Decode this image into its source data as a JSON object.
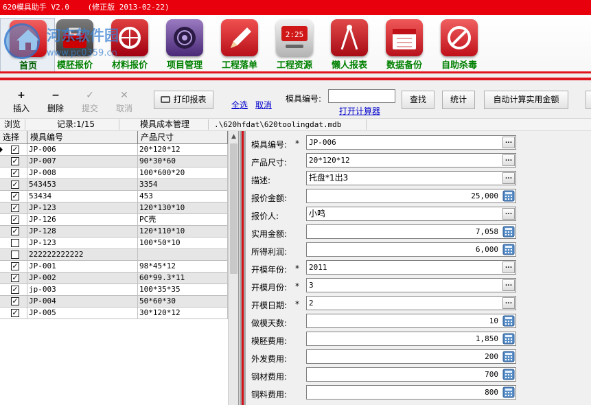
{
  "window": {
    "title": "620模具助手 V2.0    (修正版 2013-02-22)"
  },
  "watermark": {
    "text": "河东软件园",
    "url": "www.pc0359.cn"
  },
  "main_toolbar": [
    {
      "label": "首页",
      "icon": "home-icon"
    },
    {
      "label": "模胚报价",
      "icon": "toolbox-icon"
    },
    {
      "label": "材料报价",
      "icon": "material-icon"
    },
    {
      "label": "项目管理",
      "icon": "record-icon"
    },
    {
      "label": "工程落单",
      "icon": "pencil-icon"
    },
    {
      "label": "工程资源",
      "icon": "clock-device-icon"
    },
    {
      "label": "懒人报表",
      "icon": "compass-icon"
    },
    {
      "label": "数据备份",
      "icon": "calendar-icon"
    },
    {
      "label": "自助杀毒",
      "icon": "antivirus-icon"
    }
  ],
  "edit_toolbar": {
    "insert": "插入",
    "delete": "删除",
    "submit": "提交",
    "cancel": "取消",
    "print_report": "打印报表",
    "select_all": "全选",
    "deselect": "取消",
    "mold_no_label": "模具编号:",
    "mold_no_value": "",
    "open_calculator": "打开计算器",
    "search": "查找",
    "stats": "统计",
    "auto_calc": "自动计算实用金额"
  },
  "status": {
    "mode": "浏览",
    "record": "记录:1/15",
    "module": "模具成本管理",
    "db_path": ".\\620hfdat\\620toolingdat.mdb"
  },
  "grid": {
    "columns": [
      "选择",
      "模具编号",
      "产品尺寸"
    ],
    "rows": [
      {
        "checked": true,
        "mold_no": "JP-006",
        "size": "20*120*12"
      },
      {
        "checked": true,
        "mold_no": "JP-007",
        "size": "90*30*60"
      },
      {
        "checked": true,
        "mold_no": "JP-008",
        "size": "100*600*20"
      },
      {
        "checked": true,
        "mold_no": "543453",
        "size": "3354"
      },
      {
        "checked": true,
        "mold_no": "53434",
        "size": "453"
      },
      {
        "checked": true,
        "mold_no": "JP-123",
        "size": "120*130*10"
      },
      {
        "checked": true,
        "mold_no": "JP-126",
        "size": "PC壳"
      },
      {
        "checked": true,
        "mold_no": "JP-128",
        "size": "120*110*10"
      },
      {
        "checked": false,
        "mold_no": "JP-123",
        "size": "100*50*10"
      },
      {
        "checked": false,
        "mold_no": "222222222222",
        "size": ""
      },
      {
        "checked": true,
        "mold_no": "JP-001",
        "size": "98*45*12"
      },
      {
        "checked": true,
        "mold_no": "JP-002",
        "size": "60*99.3*11"
      },
      {
        "checked": true,
        "mold_no": "jp-003",
        "size": "100*35*35"
      },
      {
        "checked": true,
        "mold_no": "JP-004",
        "size": "50*60*30"
      },
      {
        "checked": true,
        "mold_no": "JP-005",
        "size": "30*120*12"
      }
    ]
  },
  "form": [
    {
      "label": "模具编号:",
      "required": true,
      "value": "JP-006",
      "kind": "text"
    },
    {
      "label": "产品尺寸:",
      "required": false,
      "value": "20*120*12",
      "kind": "text"
    },
    {
      "label": "描述:",
      "required": false,
      "value": "托盘*1出3",
      "kind": "text"
    },
    {
      "label": "报价金额:",
      "required": false,
      "value": "25,000",
      "kind": "number"
    },
    {
      "label": "报价人:",
      "required": false,
      "value": "小鸣",
      "kind": "text"
    },
    {
      "label": "实用金额:",
      "required": false,
      "value": "7,058",
      "kind": "number"
    },
    {
      "label": "所得利润:",
      "required": false,
      "value": "6,000",
      "kind": "number"
    },
    {
      "label": "开模年份:",
      "required": true,
      "value": "2011",
      "kind": "text"
    },
    {
      "label": "开模月份:",
      "required": true,
      "value": "3",
      "kind": "text"
    },
    {
      "label": "开模日期:",
      "required": true,
      "value": "2",
      "kind": "text"
    },
    {
      "label": "做模天数:",
      "required": false,
      "value": "10",
      "kind": "number"
    },
    {
      "label": "模胚费用:",
      "required": false,
      "value": "1,850",
      "kind": "number"
    },
    {
      "label": "外发费用:",
      "required": false,
      "value": "200",
      "kind": "number"
    },
    {
      "label": "钢材费用:",
      "required": false,
      "value": "700",
      "kind": "number"
    },
    {
      "label": "铜料费用:",
      "required": false,
      "value": "800",
      "kind": "number"
    }
  ],
  "colors": {
    "title_bar": "#e8000c",
    "label_green": "#008000",
    "accent_red": "#e0141c"
  }
}
